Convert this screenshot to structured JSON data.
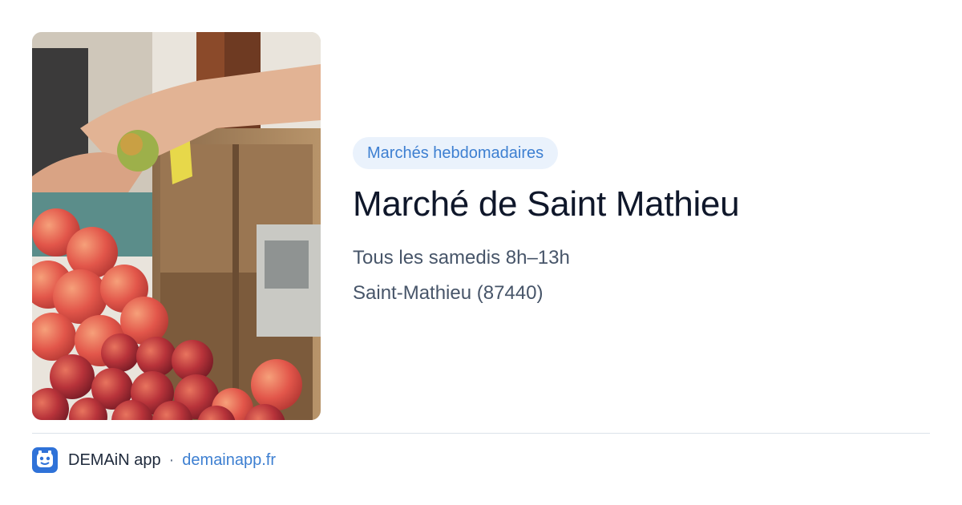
{
  "card": {
    "category": "Marchés hebdomadaires",
    "title": "Marché de Saint Mathieu",
    "schedule": "Tous les samedis 8h–13h",
    "location": "Saint-Mathieu (87440)"
  },
  "footer": {
    "brand": "DEMAiN app",
    "separator": "·",
    "website": "demainapp.fr"
  },
  "image": {
    "alt": "market-stall-apples-photo"
  },
  "colors": {
    "accent": "#3d7fd1",
    "tag_background": "#eaf2fc",
    "title": "#0f172a",
    "muted": "#475569",
    "app_icon": "#2f72d8"
  }
}
